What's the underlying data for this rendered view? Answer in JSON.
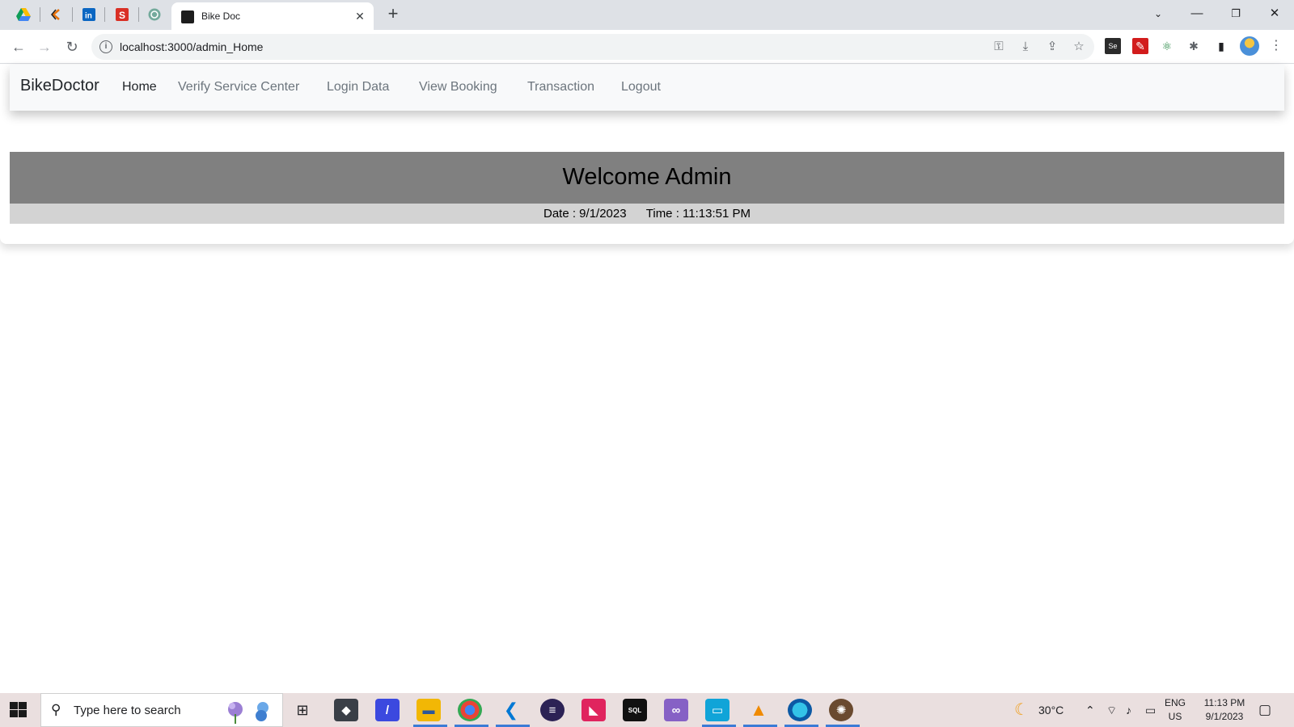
{
  "browser": {
    "tab_title": "Bike Doc",
    "url": "localhost:3000/admin_Home",
    "pinned_tabs": [
      "google-drive-icon",
      "cloud-app-icon",
      "linkedin-icon",
      "s-app-icon",
      "chatgpt-icon"
    ]
  },
  "navbar": {
    "brand": "BikeDoctor",
    "links": [
      {
        "label": "Home",
        "active": true
      },
      {
        "label": "Verify Service Center",
        "active": false
      },
      {
        "label": "Login Data",
        "active": false
      },
      {
        "label": "View Booking",
        "active": false
      },
      {
        "label": "Transaction",
        "active": false
      },
      {
        "label": "Logout",
        "active": false
      }
    ]
  },
  "banner": {
    "heading": "Welcome Admin",
    "date_text": "Date : 9/1/2023",
    "time_text": "Time : 11:13:51 PM"
  },
  "taskbar": {
    "search_placeholder": "Type here to search",
    "weather": "30°C",
    "lang_1": "ENG",
    "lang_2": "US",
    "clock_time": "11:13 PM",
    "clock_date": "9/1/2023"
  },
  "colors": {
    "banner_bg": "#808080",
    "datebar_bg": "#d3d3d3",
    "navbar_bg": "#f8f9fa"
  }
}
